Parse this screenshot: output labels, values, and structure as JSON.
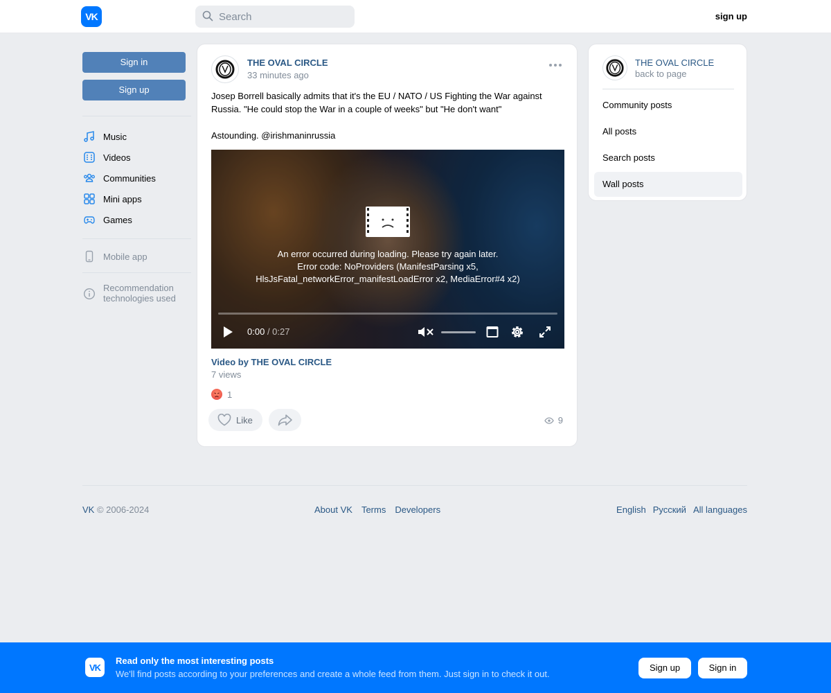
{
  "header": {
    "logo_text": "VK",
    "search_placeholder": "Search",
    "signup_label": "sign up"
  },
  "left_nav": {
    "signin_label": "Sign in",
    "signup_label": "Sign up",
    "items": [
      {
        "label": "Music",
        "icon": "music-icon"
      },
      {
        "label": "Videos",
        "icon": "video-icon"
      },
      {
        "label": "Communities",
        "icon": "communities-icon"
      },
      {
        "label": "Mini apps",
        "icon": "mini-apps-icon"
      },
      {
        "label": "Games",
        "icon": "gamepad-icon"
      }
    ],
    "mobile_app_label": "Mobile app",
    "recommendation_label": "Recommendation technologies used"
  },
  "post": {
    "author": "THE OVAL CIRCLE",
    "time": "33 minutes ago",
    "text": "Josep Borrell basically admits that it's the EU / NATO / US Fighting the War against Russia. \"He could stop the War in a couple of weeks\" but \"He don't want\"\n\nAstounding. @irishmaninrussia",
    "video": {
      "error_line1": "An error occurred during loading. Please try again later.",
      "error_line2": "Error code: NoProviders (ManifestParsing x5,",
      "error_line3": "HlsJsFatal_networkError_manifestLoadError x2, MediaError#4 x2)",
      "current_time": "0:00",
      "duration": "0:27",
      "progress": 0,
      "muted": true
    },
    "video_title": "Video by THE OVAL CIRCLE",
    "video_views": "7 views",
    "reaction_count": "1",
    "like_label": "Like",
    "view_count": "9"
  },
  "right_panel": {
    "community_name": "THE OVAL CIRCLE",
    "back_label": "back to page",
    "items": [
      "Community posts",
      "All posts",
      "Search posts",
      "Wall posts"
    ],
    "active_item": "Wall posts"
  },
  "footer": {
    "brand": "VK",
    "copyright": "© 2006-2024",
    "links": [
      "About VK",
      "Terms",
      "Developers"
    ],
    "languages": [
      "English",
      "Русский",
      "All languages"
    ]
  },
  "banner": {
    "logo_text": "VK",
    "title": "Read only the most interesting posts",
    "subtitle": "We'll find posts according to your preferences and create a whole feed from them. Just sign in to check it out.",
    "signup_label": "Sign up",
    "signin_label": "Sign in"
  },
  "colors": {
    "brand_blue": "#0077ff",
    "button_blue": "#5181b8",
    "link_blue": "#2a5885",
    "background": "#ebedf0"
  }
}
